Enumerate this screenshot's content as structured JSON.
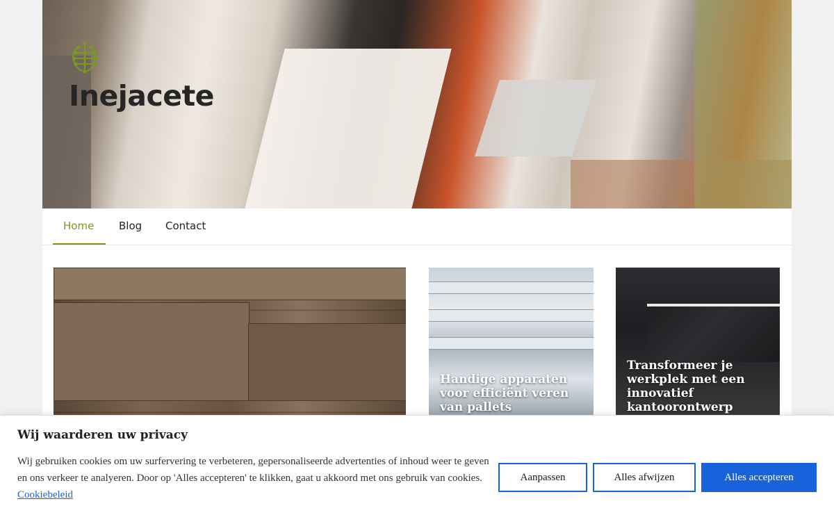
{
  "site": {
    "title": "Inejacete",
    "logo_icon": "network-brain-icon",
    "accent_color": "#7a9a1d"
  },
  "nav": {
    "items": [
      {
        "label": "Home",
        "active": true
      },
      {
        "label": "Blog",
        "active": false
      },
      {
        "label": "Contact",
        "active": false
      }
    ]
  },
  "cards": [
    {
      "title": ""
    },
    {
      "title": "Handige apparaten voor efficiënt veren van pallets"
    },
    {
      "title": "Transformeer je werkplek met een innovatief kantoorontwerp"
    }
  ],
  "cookie": {
    "title": "Wij waarderen uw privacy",
    "text": "Wij gebruiken cookies om uw surfervering te verbeteren,  gepersonaliseerde advertenties of inhoud weer te geven en ons verkeer te analyeren. Door op 'Alles accepteren' te klikken, gaat u akkoord met ons gebruik van cookies.",
    "link": "Cookiebeleid",
    "buttons": {
      "customize": "Aanpassen",
      "reject": "Alles afwijzen",
      "accept": "Alles accepteren"
    },
    "button_color": "#1863dc"
  }
}
